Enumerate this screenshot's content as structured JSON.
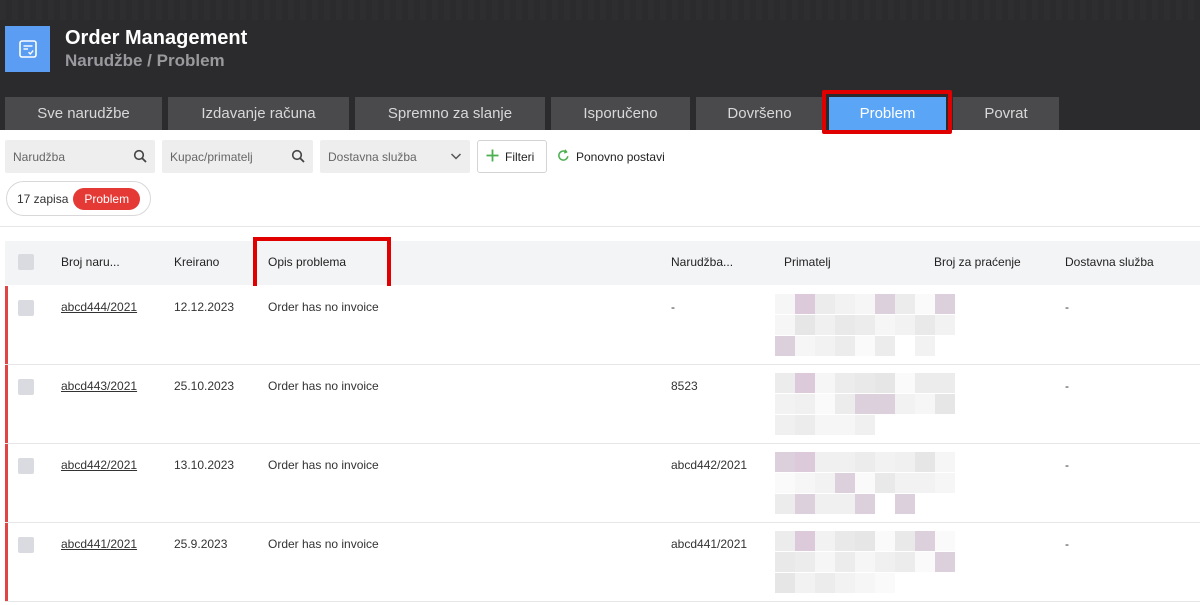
{
  "header": {
    "title": "Order Management",
    "breadcrumb": "Narudžbe / Problem",
    "icon": "checklist-icon"
  },
  "tabs": [
    {
      "label": "Sve narudžbe",
      "active": false
    },
    {
      "label": "Izdavanje računa",
      "active": false
    },
    {
      "label": "Spremno za slanje",
      "active": false
    },
    {
      "label": "Isporučeno",
      "active": false
    },
    {
      "label": "Dovršeno",
      "active": false
    },
    {
      "label": "Problem",
      "active": true
    },
    {
      "label": "Povrat",
      "active": false
    }
  ],
  "filters": {
    "order_placeholder": "Narudžba",
    "customer_placeholder": "Kupac/primatelj",
    "delivery_placeholder": "Dostavna služba",
    "filters_button": "Filteri",
    "reset_button": "Ponovno postavi"
  },
  "summary": {
    "count_text": "17 zapisa",
    "status_badge": "Problem"
  },
  "table": {
    "columns": [
      "Broj naru...",
      "Kreirano",
      "Opis problema",
      "Narudžba...",
      "Primatelj",
      "Broj za praćenje",
      "Dostavna služba"
    ],
    "rows": [
      {
        "order": "abcd444/2021",
        "created": "12.12.2023",
        "problem": "Order has no invoice",
        "order_ref": "-",
        "tracking": "",
        "delivery": "-"
      },
      {
        "order": "abcd443/2021",
        "created": "25.10.2023",
        "problem": "Order has no invoice",
        "order_ref": "8523",
        "tracking": "",
        "delivery": "-"
      },
      {
        "order": "abcd442/2021",
        "created": "13.10.2023",
        "problem": "Order has no invoice",
        "order_ref": "abcd442/2021",
        "tracking": "",
        "delivery": "-"
      },
      {
        "order": "abcd441/2021",
        "created": "25.9.2023",
        "problem": "Order has no invoice",
        "order_ref": "abcd441/2021",
        "tracking": "",
        "delivery": "-"
      }
    ]
  },
  "colors": {
    "header_bg": "#2b2b2d",
    "tab_bg": "#4a4a4d",
    "tab_active": "#5aa5f5",
    "highlight": "#e10000",
    "problem_badge": "#e53935"
  }
}
